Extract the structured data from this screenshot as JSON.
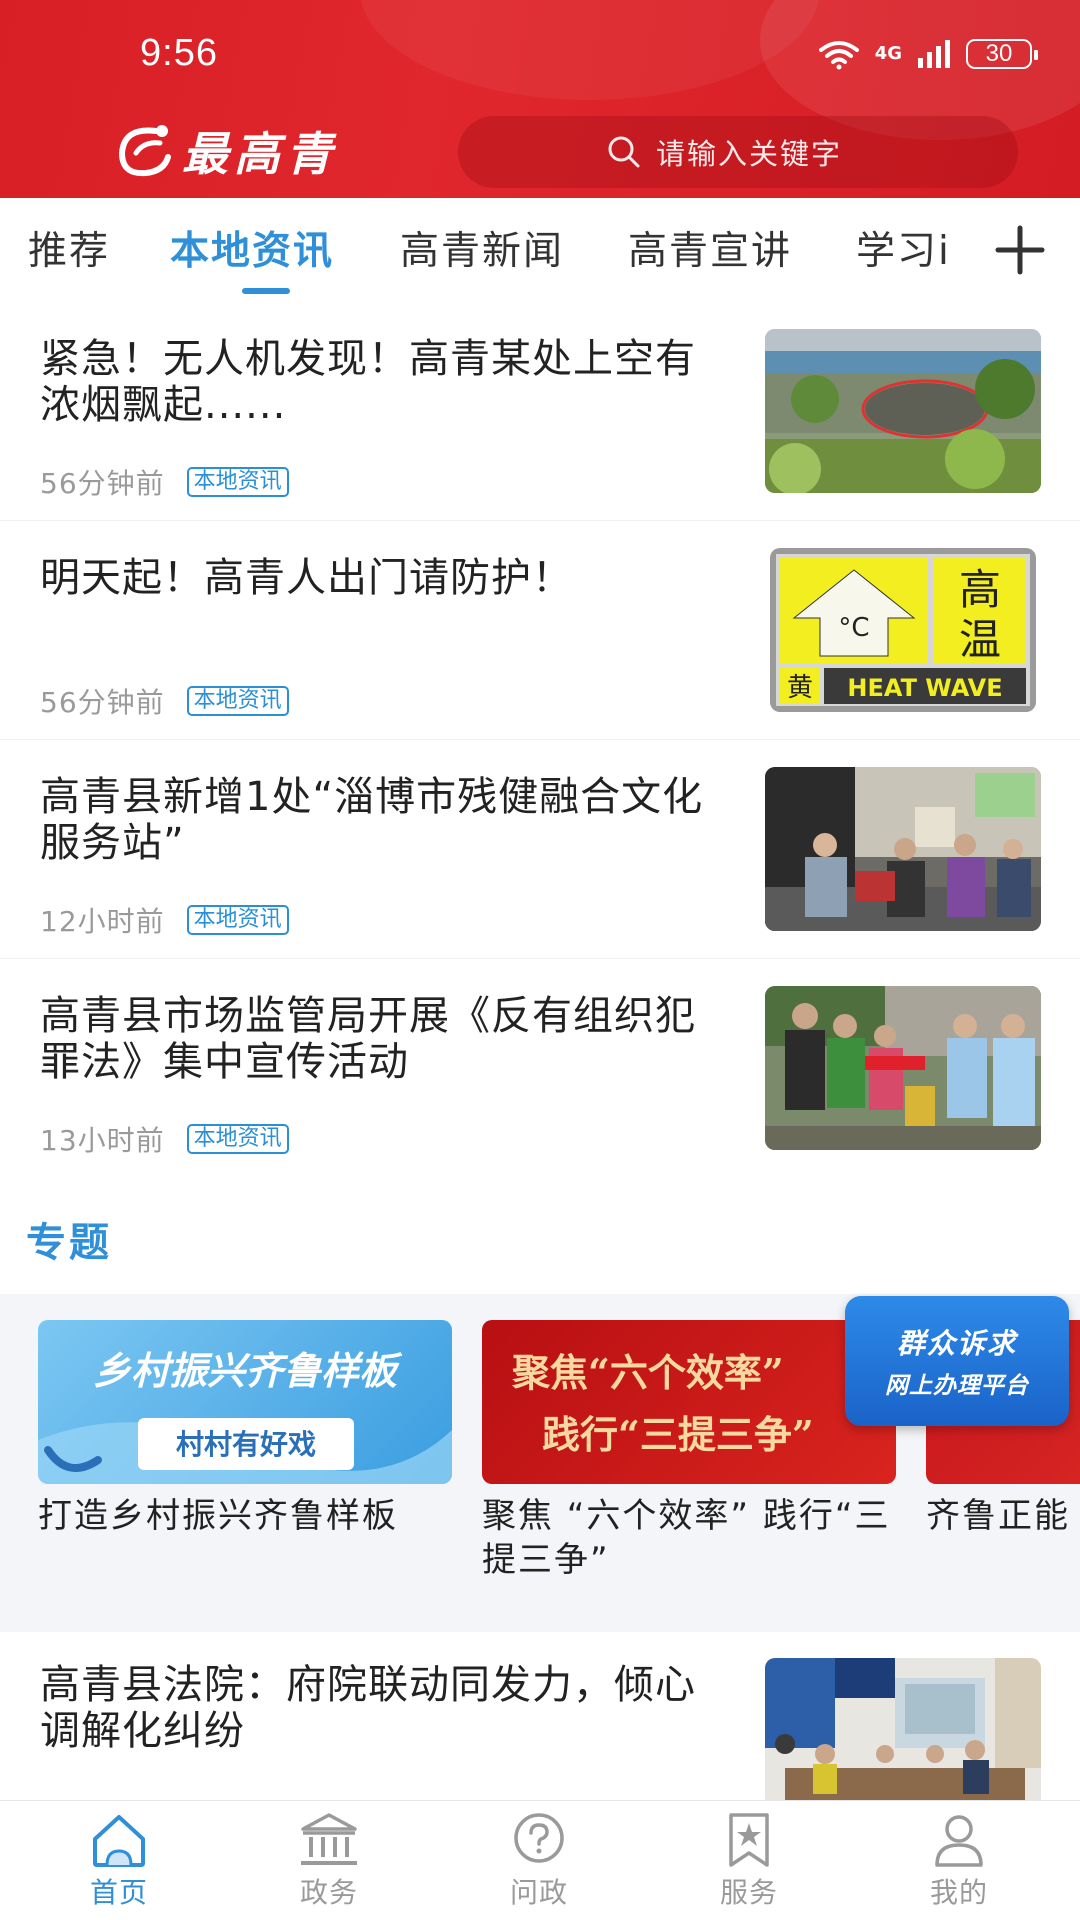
{
  "status_bar": {
    "time": "9:56",
    "network": "4G",
    "battery": "30"
  },
  "header": {
    "logo_text": "最高青",
    "search_placeholder": "请输入关键字"
  },
  "tabs": [
    {
      "label": "推荐",
      "active": false
    },
    {
      "label": "本地资讯",
      "active": true
    },
    {
      "label": "高青新闻",
      "active": false
    },
    {
      "label": "高青宣讲",
      "active": false
    },
    {
      "label": "学习i",
      "active": false
    }
  ],
  "news": [
    {
      "title": "紧急！无人机发现！高青某处上空有浓烟飘起......",
      "time": "56分钟前",
      "tag": "本地资讯",
      "thumb": "drone-smoke-photo"
    },
    {
      "title": "明天起！高青人出门请防护！",
      "time": "56分钟前",
      "tag": "本地资讯",
      "thumb": "heat-wave-warning"
    },
    {
      "title": "高青县新增1处“淄博市残健融合文化服务站”",
      "time": "12小时前",
      "tag": "本地资讯",
      "thumb": "service-station-photo"
    },
    {
      "title": "高青县市场监管局开展《反有组织犯罪法》集中宣传活动",
      "time": "13小时前",
      "tag": "本地资讯",
      "thumb": "propaganda-activity-photo"
    }
  ],
  "warning_sign": {
    "line1": "高",
    "line2": "温",
    "level": "黄",
    "english": "HEAT WAVE",
    "unit": "°C"
  },
  "topics": {
    "title": "专题",
    "items": [
      {
        "banner_main": "乡村振兴齐鲁样板",
        "banner_sub": "村村有好戏",
        "caption": "打造乡村振兴齐鲁样板"
      },
      {
        "banner_main": "聚焦“六个效率”",
        "banner_sub": "践行“三提三争”",
        "caption": "聚焦 “六个效率” 践行“三提三争”"
      },
      {
        "banner_main": "",
        "banner_sub": "",
        "caption": "齐鲁正能"
      }
    ]
  },
  "float_badge": {
    "line1": "群众诉求",
    "line2": "网上办理平台"
  },
  "news_extra": {
    "title": "高青县法院：府院联动同发力，倾心调解化纠纷",
    "thumb": "court-meeting-photo"
  },
  "bottom_nav": [
    {
      "label": "首页",
      "icon": "home-icon",
      "active": true
    },
    {
      "label": "政务",
      "icon": "government-icon",
      "active": false
    },
    {
      "label": "问政",
      "icon": "question-icon",
      "active": false
    },
    {
      "label": "服务",
      "icon": "bookmark-star-icon",
      "active": false
    },
    {
      "label": "我的",
      "icon": "user-icon",
      "active": false
    }
  ],
  "colors": {
    "header_red": "#d81f26",
    "accent_blue": "#2f8fd8",
    "tag_blue": "#2a8fd6",
    "float_blue": "#1a63c8"
  }
}
